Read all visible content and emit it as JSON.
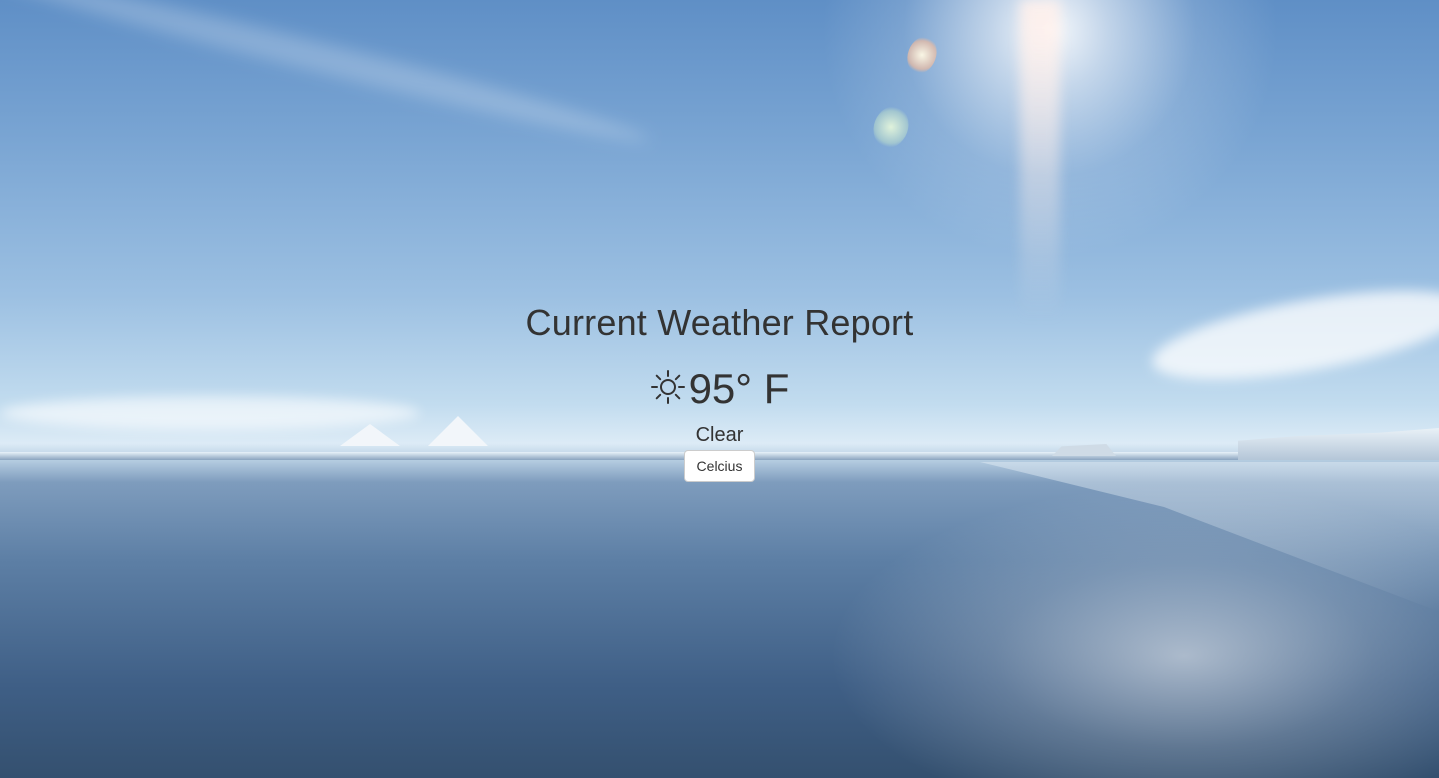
{
  "header": {
    "title": "Current Weather Report"
  },
  "weather": {
    "icon": "sun-icon",
    "temperature": "95° F",
    "condition": "Clear"
  },
  "controls": {
    "unit_toggle_label": "Celcius"
  },
  "colors": {
    "text": "#333333",
    "button_bg": "#ffffff",
    "button_border": "#cccccc"
  }
}
